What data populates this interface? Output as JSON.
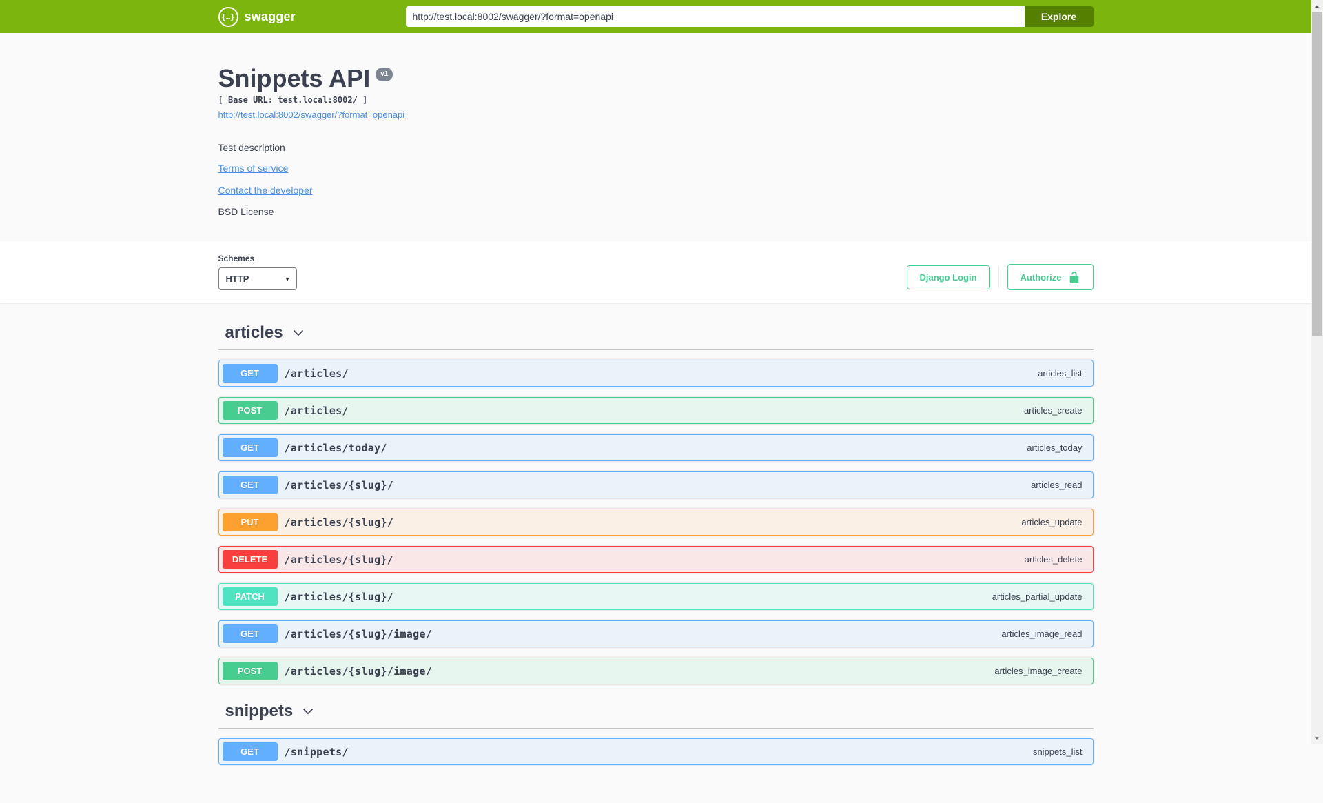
{
  "topbar": {
    "logo_text": "swagger",
    "logo_glyph": "{…}",
    "url_value": "http://test.local:8002/swagger/?format=openapi",
    "explore_label": "Explore"
  },
  "info": {
    "title": "Snippets API",
    "version_badge": "v1",
    "base_url_line": "[ Base URL: test.local:8002/ ]",
    "spec_link": "http://test.local:8002/swagger/?format=openapi",
    "description": "Test description",
    "terms_link": "Terms of service",
    "contact_link": "Contact the developer",
    "license": "BSD License"
  },
  "schemes": {
    "label": "Schemes",
    "selected": "HTTP",
    "django_login_label": "Django Login",
    "authorize_label": "Authorize"
  },
  "sections": [
    {
      "name": "articles",
      "operations": [
        {
          "method": "GET",
          "path": "/articles/",
          "op_id": "articles_list"
        },
        {
          "method": "POST",
          "path": "/articles/",
          "op_id": "articles_create"
        },
        {
          "method": "GET",
          "path": "/articles/today/",
          "op_id": "articles_today"
        },
        {
          "method": "GET",
          "path": "/articles/{slug}/",
          "op_id": "articles_read"
        },
        {
          "method": "PUT",
          "path": "/articles/{slug}/",
          "op_id": "articles_update"
        },
        {
          "method": "DELETE",
          "path": "/articles/{slug}/",
          "op_id": "articles_delete"
        },
        {
          "method": "PATCH",
          "path": "/articles/{slug}/",
          "op_id": "articles_partial_update"
        },
        {
          "method": "GET",
          "path": "/articles/{slug}/image/",
          "op_id": "articles_image_read"
        },
        {
          "method": "POST",
          "path": "/articles/{slug}/image/",
          "op_id": "articles_image_create"
        }
      ]
    },
    {
      "name": "snippets",
      "operations": [
        {
          "method": "GET",
          "path": "/snippets/",
          "op_id": "snippets_list"
        }
      ]
    }
  ],
  "colors": {
    "topbar": "#7cb50e",
    "explore_button": "#547f00",
    "accent_green": "#49cc90",
    "link": "#4990e2",
    "text": "#3b4151",
    "GET": "#61affe",
    "POST": "#49cc90",
    "PUT": "#fca130",
    "DELETE": "#f93e3e",
    "PATCH": "#50e3c2"
  },
  "icons": {
    "scroll_up": "▲",
    "scroll_down": "▼",
    "select_chevron": "▼"
  }
}
